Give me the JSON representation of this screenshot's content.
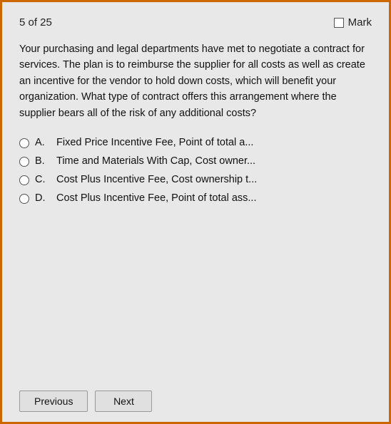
{
  "header": {
    "counter": "5 of 25",
    "mark_label": "Mark"
  },
  "question": {
    "text": "Your purchasing and legal departments have met to negotiate a contract for services. The plan is to reimburse the supplier for all costs as well as create an incentive for the vendor to hold down costs, which will benefit your organization. What type of contract offers this arrangement where the supplier bears all of the risk of any additional costs?"
  },
  "options": [
    {
      "letter": "A.",
      "text": "Fixed Price Incentive Fee, Point of total a..."
    },
    {
      "letter": "B.",
      "text": "Time and Materials With Cap, Cost owner..."
    },
    {
      "letter": "C.",
      "text": "Cost Plus Incentive Fee, Cost ownership t..."
    },
    {
      "letter": "D.",
      "text": "Cost Plus Incentive Fee, Point of total ass..."
    }
  ],
  "footer": {
    "previous_label": "Previous",
    "next_label": "Next"
  }
}
